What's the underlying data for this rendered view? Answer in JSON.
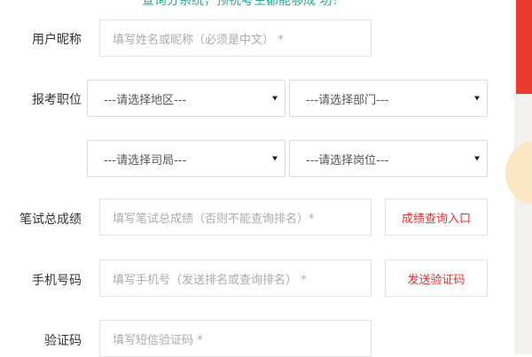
{
  "top_note": "查询分系统，预祝考生都能够成 功！",
  "form": {
    "nickname": {
      "label": "用户昵称",
      "placeholder": "填写姓名或昵称（必须是中文） *"
    },
    "position": {
      "label": "报考职位",
      "region": "---请选择地区---",
      "department": "---请选择部门---",
      "bureau": "---请选择司局---",
      "post": "---请选择岗位---"
    },
    "score": {
      "label": "笔试总成绩",
      "placeholder": "填写笔试总成绩（否则不能查询排名）*",
      "button": "成绩查询入口"
    },
    "phone": {
      "label": "手机号码",
      "placeholder": "填写手机号（发送排名或查询排名） *",
      "button": "发送验证码"
    },
    "code": {
      "label": "验证码",
      "placeholder": "填写短信验证码 *"
    }
  },
  "colors": {
    "accent_red": "#e03030",
    "note_green": "#2aa59a",
    "brand_red": "#e83a2e"
  }
}
